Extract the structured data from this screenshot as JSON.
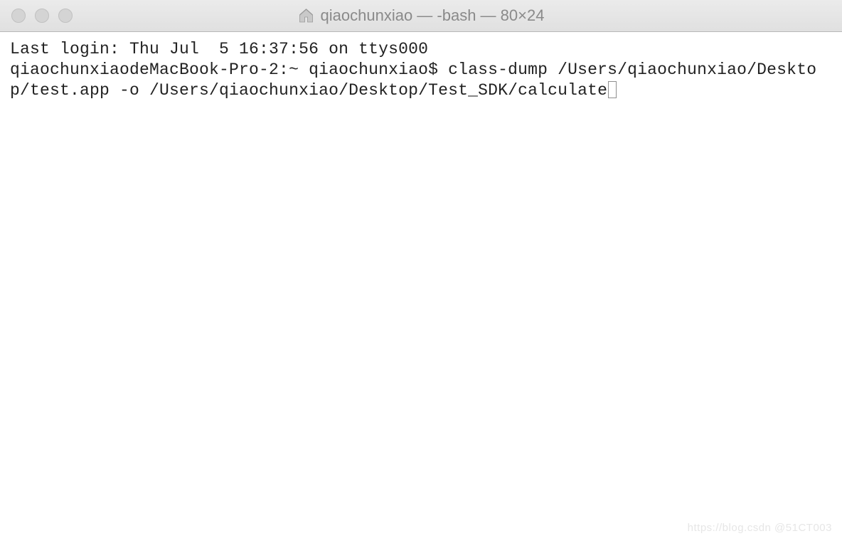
{
  "window": {
    "title": "qiaochunxiao — -bash — 80×24"
  },
  "terminal": {
    "last_login_line": "Last login: Thu Jul  5 16:37:56 on ttys000",
    "prompt": "qiaochunxiaodeMacBook-Pro-2:~ qiaochunxiao$ ",
    "command": "class-dump /Users/qiaochunxiao/Desktop/test.app -o /Users/qiaochunxiao/Desktop/Test_SDK/calculate"
  },
  "watermark": "https://blog.csdn @51CT003"
}
